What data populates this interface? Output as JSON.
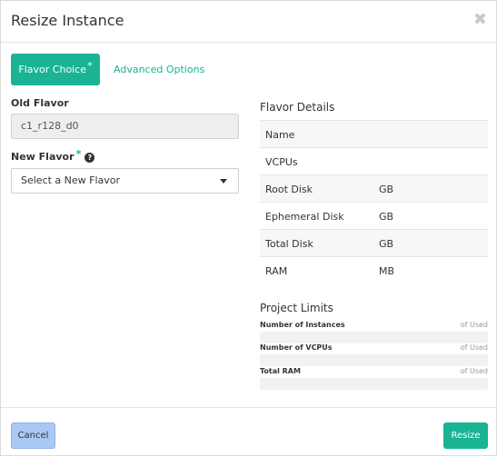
{
  "header": {
    "title": "Resize Instance",
    "close_glyph": "✖"
  },
  "tabs": [
    {
      "label": "Flavor Choice",
      "required": "*",
      "active": true
    },
    {
      "label": "Advanced Options",
      "active": false
    }
  ],
  "form": {
    "old_flavor_label": "Old Flavor",
    "old_flavor_value": "c1_r128_d0",
    "new_flavor_label": "New Flavor",
    "new_flavor_required": "*",
    "help_glyph": "?",
    "new_flavor_selected": "Select a New Flavor"
  },
  "details": {
    "title": "Flavor Details",
    "rows": [
      {
        "name": "Name",
        "value": ""
      },
      {
        "name": "VCPUs",
        "value": ""
      },
      {
        "name": "Root Disk",
        "value": "GB"
      },
      {
        "name": "Ephemeral Disk",
        "value": "GB"
      },
      {
        "name": "Total Disk",
        "value": "GB"
      },
      {
        "name": "RAM",
        "value": "MB"
      }
    ]
  },
  "limits": {
    "title": "Project Limits",
    "items": [
      {
        "name": "Number of Instances",
        "used": "of Used"
      },
      {
        "name": "Number of VCPUs",
        "used": "of Used"
      },
      {
        "name": "Total RAM",
        "used": "of Used"
      }
    ]
  },
  "footer": {
    "cancel_label": "Cancel",
    "resize_label": "Resize"
  },
  "colors": {
    "accent": "#1ab394",
    "cancel_bg": "#a9c9f4"
  }
}
